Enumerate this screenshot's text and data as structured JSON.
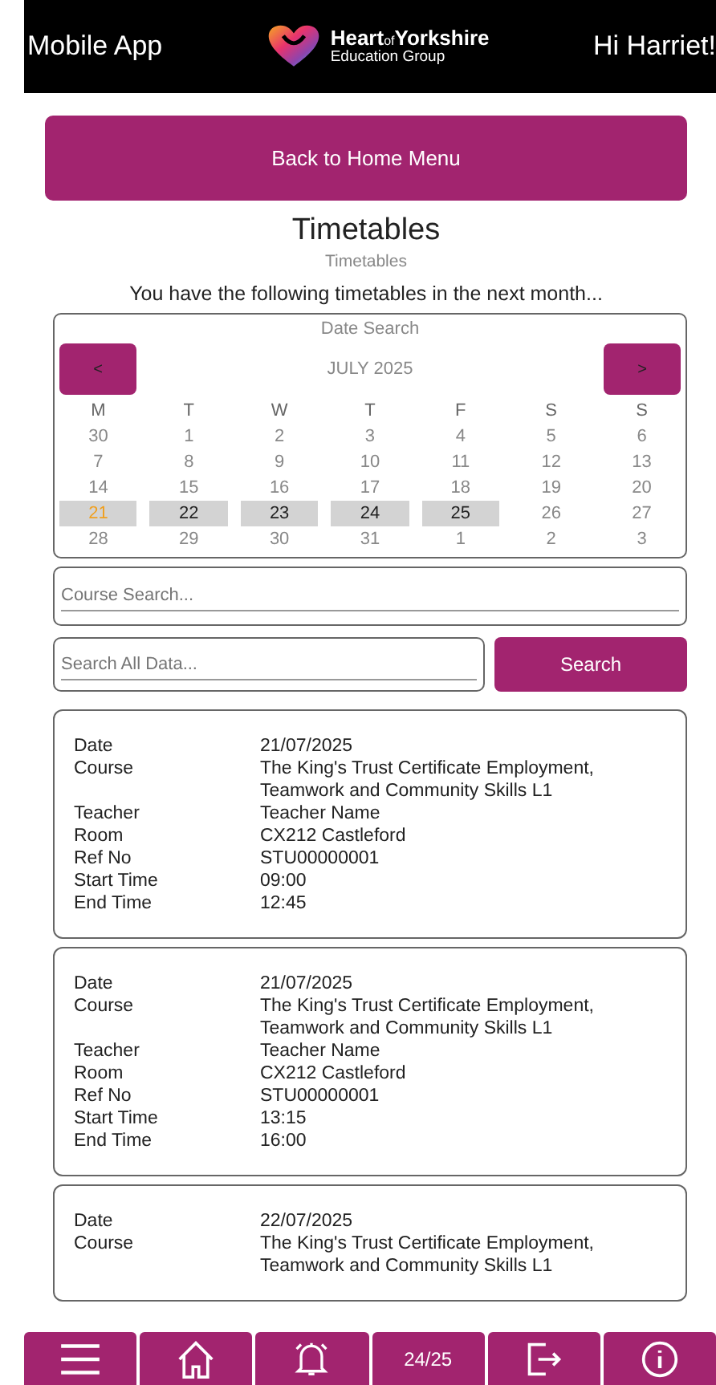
{
  "header": {
    "app_name": "Mobile App",
    "logo_line_1_bold": "Heart",
    "logo_line_1_small": "of",
    "logo_line_1_end": "Yorkshire",
    "logo_line_2": "Education Group",
    "greeting": "Hi Harriet!"
  },
  "back_button": "Back to Home Menu",
  "title": "Timetables",
  "subtitle": "Timetables",
  "intro": "You have the following timetables in the next month...",
  "calendar": {
    "heading": "Date Search",
    "month": "JULY 2025",
    "prev": "<",
    "next": ">",
    "weekdays": [
      "M",
      "T",
      "W",
      "T",
      "F",
      "S",
      "S"
    ],
    "days": [
      {
        "label": "30",
        "highlighted": false,
        "today": false
      },
      {
        "label": "1",
        "highlighted": false,
        "today": false
      },
      {
        "label": "2",
        "highlighted": false,
        "today": false
      },
      {
        "label": "3",
        "highlighted": false,
        "today": false
      },
      {
        "label": "4",
        "highlighted": false,
        "today": false
      },
      {
        "label": "5",
        "highlighted": false,
        "today": false
      },
      {
        "label": "6",
        "highlighted": false,
        "today": false
      },
      {
        "label": "7",
        "highlighted": false,
        "today": false
      },
      {
        "label": "8",
        "highlighted": false,
        "today": false
      },
      {
        "label": "9",
        "highlighted": false,
        "today": false
      },
      {
        "label": "10",
        "highlighted": false,
        "today": false
      },
      {
        "label": "11",
        "highlighted": false,
        "today": false
      },
      {
        "label": "12",
        "highlighted": false,
        "today": false
      },
      {
        "label": "13",
        "highlighted": false,
        "today": false
      },
      {
        "label": "14",
        "highlighted": false,
        "today": false
      },
      {
        "label": "15",
        "highlighted": false,
        "today": false
      },
      {
        "label": "16",
        "highlighted": false,
        "today": false
      },
      {
        "label": "17",
        "highlighted": false,
        "today": false
      },
      {
        "label": "18",
        "highlighted": false,
        "today": false
      },
      {
        "label": "19",
        "highlighted": false,
        "today": false
      },
      {
        "label": "20",
        "highlighted": false,
        "today": false
      },
      {
        "label": "21",
        "highlighted": true,
        "today": true
      },
      {
        "label": "22",
        "highlighted": true,
        "today": false
      },
      {
        "label": "23",
        "highlighted": true,
        "today": false
      },
      {
        "label": "24",
        "highlighted": true,
        "today": false
      },
      {
        "label": "25",
        "highlighted": true,
        "today": false
      },
      {
        "label": "26",
        "highlighted": false,
        "today": false
      },
      {
        "label": "27",
        "highlighted": false,
        "today": false
      },
      {
        "label": "28",
        "highlighted": false,
        "today": false
      },
      {
        "label": "29",
        "highlighted": false,
        "today": false
      },
      {
        "label": "30",
        "highlighted": false,
        "today": false
      },
      {
        "label": "31",
        "highlighted": false,
        "today": false
      },
      {
        "label": "1",
        "highlighted": false,
        "today": false
      },
      {
        "label": "2",
        "highlighted": false,
        "today": false
      },
      {
        "label": "3",
        "highlighted": false,
        "today": false
      }
    ]
  },
  "course_search": {
    "placeholder": "Course Search..."
  },
  "data_search": {
    "placeholder": "Search All Data...",
    "button": "Search"
  },
  "timetables": [
    {
      "rows": [
        {
          "label": "Date",
          "value": "21/07/2025"
        },
        {
          "label": "Course",
          "value": "The King's Trust Certificate Employment, Teamwork and Community Skills L1"
        },
        {
          "label": "Teacher",
          "value": "Teacher Name"
        },
        {
          "label": "Room",
          "value": "CX212 Castleford"
        },
        {
          "label": "Ref No",
          "value": "STU00000001"
        },
        {
          "label": "Start Time",
          "value": "09:00"
        },
        {
          "label": "End Time",
          "value": "12:45"
        }
      ]
    },
    {
      "rows": [
        {
          "label": "Date",
          "value": "21/07/2025"
        },
        {
          "label": "Course",
          "value": "The King's Trust Certificate Employment, Teamwork and Community Skills L1"
        },
        {
          "label": "Teacher",
          "value": "Teacher Name"
        },
        {
          "label": "Room",
          "value": "CX212 Castleford"
        },
        {
          "label": "Ref No",
          "value": "STU00000001"
        },
        {
          "label": "Start Time",
          "value": "13:15"
        },
        {
          "label": "End Time",
          "value": "16:00"
        }
      ]
    },
    {
      "rows": [
        {
          "label": "Date",
          "value": "22/07/2025"
        },
        {
          "label": "Course",
          "value": "The King's Trust Certificate Employment, Teamwork and Community Skills L1"
        }
      ]
    }
  ],
  "bottom_nav": [
    {
      "kind": "menu"
    },
    {
      "kind": "home"
    },
    {
      "kind": "bell"
    },
    {
      "kind": "text",
      "label": "24/25"
    },
    {
      "kind": "exit"
    },
    {
      "kind": "info"
    }
  ]
}
